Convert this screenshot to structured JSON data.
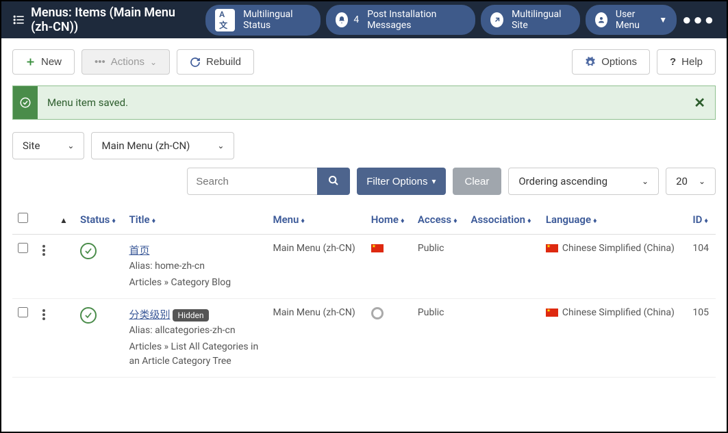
{
  "topbar": {
    "title": "Menus: Items (Main Menu (zh-CN))",
    "multilingual_status": "Multilingual Status",
    "post_install_count": "4",
    "post_install": "Post Installation Messages",
    "multilingual_site": "Multilingual Site",
    "user_menu": "User Menu"
  },
  "toolbar": {
    "new": "New",
    "actions": "Actions",
    "rebuild": "Rebuild",
    "options": "Options",
    "help": "Help"
  },
  "alert": {
    "message": "Menu item saved."
  },
  "filters": {
    "client": "Site",
    "menu": "Main Menu (zh-CN)",
    "search_placeholder": "Search",
    "filter_options": "Filter Options",
    "clear": "Clear",
    "ordering": "Ordering ascending",
    "limit": "20"
  },
  "columns": {
    "status": "Status",
    "title": "Title",
    "menu": "Menu",
    "home": "Home",
    "access": "Access",
    "association": "Association",
    "language": "Language",
    "id": "ID"
  },
  "rows": [
    {
      "title": "首页",
      "alias": "Alias: home-zh-cn",
      "path": "Articles » Category Blog",
      "hidden": false,
      "menu": "Main Menu (zh-CN)",
      "home": "flag",
      "access": "Public",
      "language": "Chinese Simplified (China)",
      "id": "104"
    },
    {
      "title": "分类级别",
      "alias": "Alias: allcategories-zh-cn",
      "path": "Articles » List All Categories in an Article Category Tree",
      "hidden": true,
      "hidden_label": "Hidden",
      "menu": "Main Menu (zh-CN)",
      "home": "radio",
      "access": "Public",
      "language": "Chinese Simplified (China)",
      "id": "105"
    }
  ]
}
